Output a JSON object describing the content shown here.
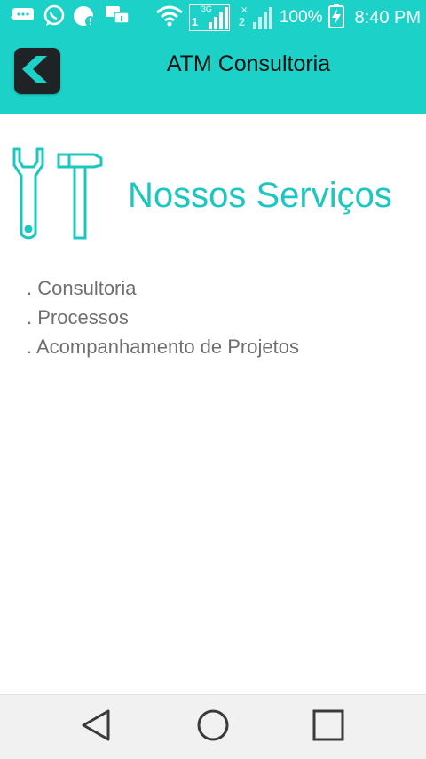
{
  "status_bar": {
    "battery": "100%",
    "time": "8:40 PM",
    "network_badge": "3G",
    "sim1": "1",
    "sim2": "2",
    "icons": [
      "message-icon",
      "whatsapp-icon",
      "notification-icon",
      "chat-icon",
      "wifi-icon",
      "signal-sim1-icon",
      "signal-sim2-icon",
      "battery-charging-icon"
    ]
  },
  "app_bar": {
    "title": "ATM Consultoria",
    "back_icon": "back-logo-icon"
  },
  "main": {
    "section_icon": "tools-icon",
    "section_title": "Nossos Serviços",
    "services": [
      ". Consultoria",
      ". Processos",
      ". Acompanhamento de Projetos"
    ]
  },
  "nav_bar": {
    "buttons": [
      "back-nav-icon",
      "home-nav-icon",
      "recents-nav-icon"
    ]
  },
  "colors": {
    "accent": "#1cd2c8",
    "title_teal": "#1cc7bf",
    "text_gray": "#6f6f6f",
    "nav_bg": "#f1f1f1"
  }
}
